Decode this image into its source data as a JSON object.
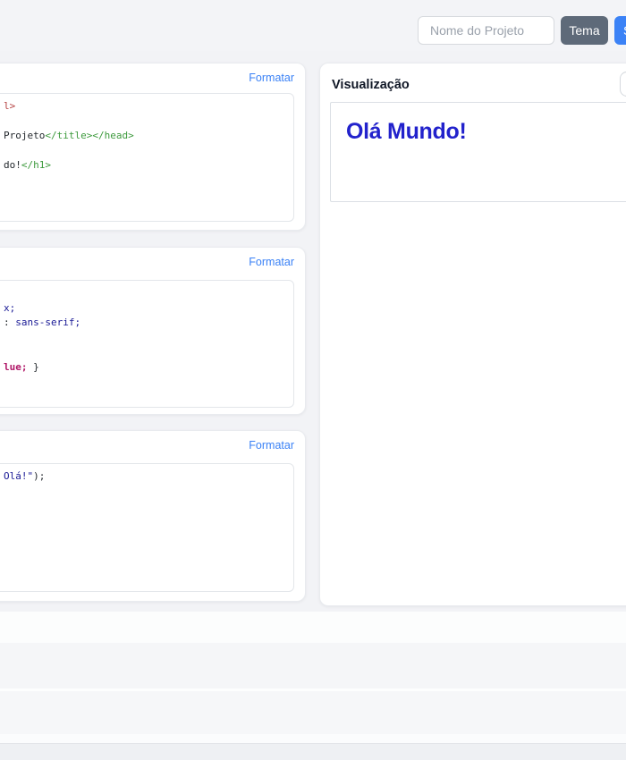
{
  "header": {
    "project_name_placeholder": "Nome do Projeto",
    "theme_button_label": "Tema",
    "save_button_label": "Salvar"
  },
  "colors": {
    "accent_blue": "#3b82f6",
    "theme_button_gray": "#5e6a79",
    "preview_heading_blue": "#2222cc",
    "page_background": "#f2f3f6"
  },
  "code_colors": {
    "fg": "#24292e",
    "red": "#b54141",
    "green": "#3d9a3d",
    "navy": "#1a1a96",
    "magenta": "#b01868"
  },
  "editors": [
    {
      "id": "html",
      "format_label": "Formatar",
      "lines": [
        [
          {
            "t": "l>",
            "c": "red"
          }
        ],
        [],
        [
          {
            "t": "Projeto",
            "c": "fg"
          },
          {
            "t": "</title></head>",
            "c": "green"
          }
        ],
        [],
        [
          {
            "t": "do!",
            "c": "fg"
          },
          {
            "t": "</h1>",
            "c": "green"
          }
        ]
      ]
    },
    {
      "id": "css",
      "format_label": "Formatar",
      "lines": [
        [],
        [
          {
            "t": "x;",
            "c": "navy"
          }
        ],
        [
          {
            "t": ": ",
            "c": "fg"
          },
          {
            "t": "sans-serif;",
            "c": "navy"
          }
        ],
        [],
        [],
        [
          {
            "t": "lue;",
            "c": "magenta",
            "b": true
          },
          {
            "t": " }",
            "c": "fg"
          }
        ]
      ]
    },
    {
      "id": "js",
      "format_label": "Formatar",
      "lines": [
        [
          {
            "t": "Olá!\"",
            "c": "navy"
          },
          {
            "t": ");",
            "c": "fg"
          }
        ]
      ]
    }
  ],
  "preview": {
    "title": "Visualização",
    "content_heading": "Olá Mundo!"
  }
}
